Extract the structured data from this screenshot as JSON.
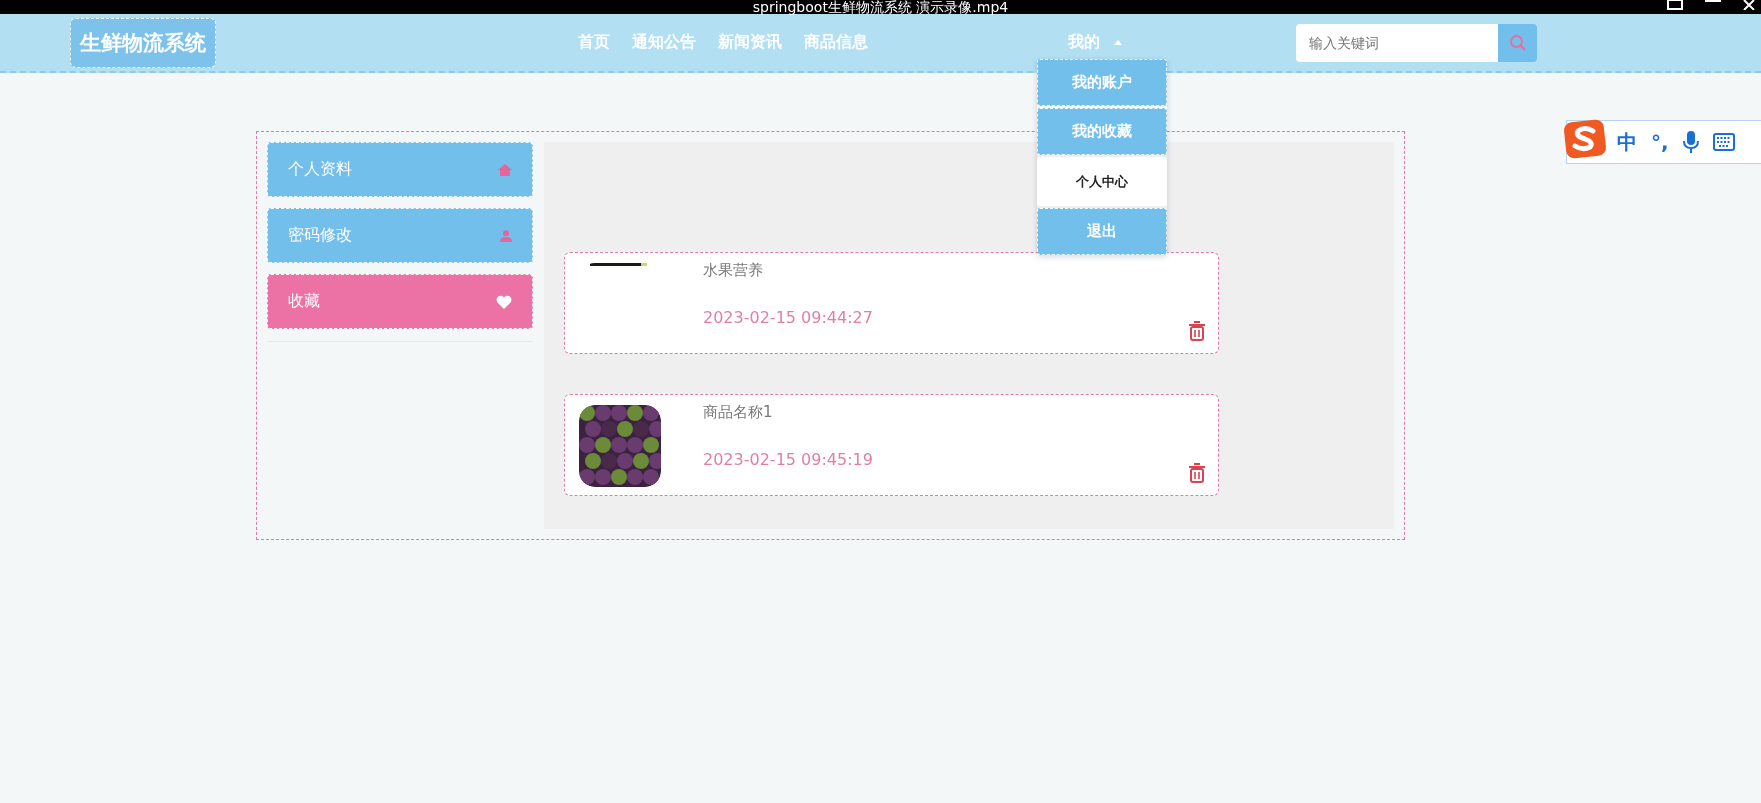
{
  "video_title": "springboot生鲜物流系统 演示录像.mp4",
  "site": {
    "logo": "生鲜物流系统",
    "nav": [
      "首页",
      "通知公告",
      "新闻资讯",
      "商品信息"
    ],
    "account_menu": {
      "label": "我的",
      "expanded": true,
      "items": [
        {
          "label": "我的账户",
          "selected": false
        },
        {
          "label": "我的收藏",
          "selected": false
        },
        {
          "label": "个人中心",
          "selected": true
        },
        {
          "label": "退出",
          "selected": false
        }
      ]
    },
    "search": {
      "placeholder": "输入关键词"
    }
  },
  "sidebar": [
    {
      "label": "个人资料",
      "kind": "home",
      "selected": false
    },
    {
      "label": "密码修改",
      "kind": "user",
      "selected": false
    },
    {
      "label": "收藏",
      "kind": "heart",
      "selected": true
    }
  ],
  "favorites": [
    {
      "name": "水果营养",
      "time": "2023-02-15 09:44:27"
    },
    {
      "name": "商品名称1",
      "time": "2023-02-15 09:45:19"
    }
  ],
  "ime": {
    "mode": "中",
    "punctuation": "°,"
  }
}
